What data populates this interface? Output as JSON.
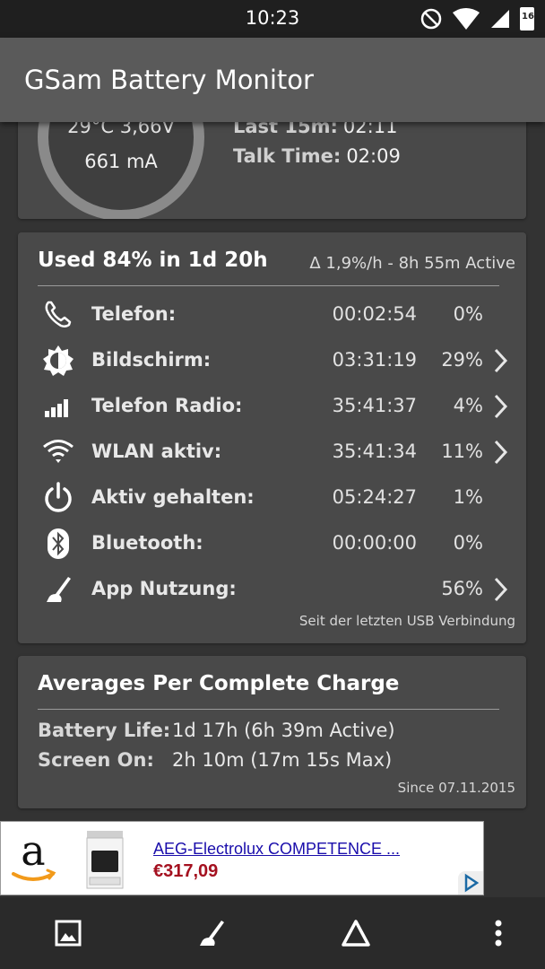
{
  "status_bar": {
    "time": "10:23",
    "battery_level": "16"
  },
  "app_bar": {
    "title": "GSam Battery Monitor"
  },
  "summary": {
    "temperature_voltage": "29°C  3,66V",
    "current": "661 mA",
    "last15_key": "Last 15m:",
    "last15_val": "02:11",
    "talk_key": "Talk Time:",
    "talk_val": "02:09"
  },
  "usage": {
    "heading": "Used 84% in 1d 20h",
    "rate": "Δ 1,9%/h - 8h 55m Active",
    "rows": [
      {
        "label": "Telefon:",
        "time": "00:02:54",
        "pct": "0%",
        "icon": "phone-icon",
        "chevron": false
      },
      {
        "label": "Bildschirm:",
        "time": "03:31:19",
        "pct": "29%",
        "icon": "brightness-icon",
        "chevron": true
      },
      {
        "label": "Telefon Radio:",
        "time": "35:41:37",
        "pct": "4%",
        "icon": "signal-bars-icon",
        "chevron": true
      },
      {
        "label": "WLAN aktiv:",
        "time": "35:41:34",
        "pct": "11%",
        "icon": "wifi-icon",
        "chevron": true
      },
      {
        "label": "Aktiv gehalten:",
        "time": "05:24:27",
        "pct": "1%",
        "icon": "power-icon",
        "chevron": false
      },
      {
        "label": "Bluetooth:",
        "time": "00:00:00",
        "pct": "0%",
        "icon": "bluetooth-icon",
        "chevron": false
      },
      {
        "label": "App Nutzung:",
        "time": "",
        "pct": "56%",
        "icon": "app-usage-icon",
        "chevron": true
      }
    ],
    "footer": "Seit der letzten USB Verbindung"
  },
  "averages": {
    "heading": "Averages Per Complete Charge",
    "battery_life_key": "Battery Life:",
    "battery_life_val": "1d 17h (6h 39m Active)",
    "screen_on_key": "Screen On:",
    "screen_on_val": "2h 10m (17m 15s Max)",
    "footer": "Since 07.11.2015"
  },
  "ad": {
    "product_name": "AEG-Electrolux COMPETENCE ...",
    "price": "€317,09"
  },
  "colors": {
    "card": "#494949",
    "background": "#333333",
    "appbar": "#5a5a5a",
    "price": "#a4101f"
  }
}
